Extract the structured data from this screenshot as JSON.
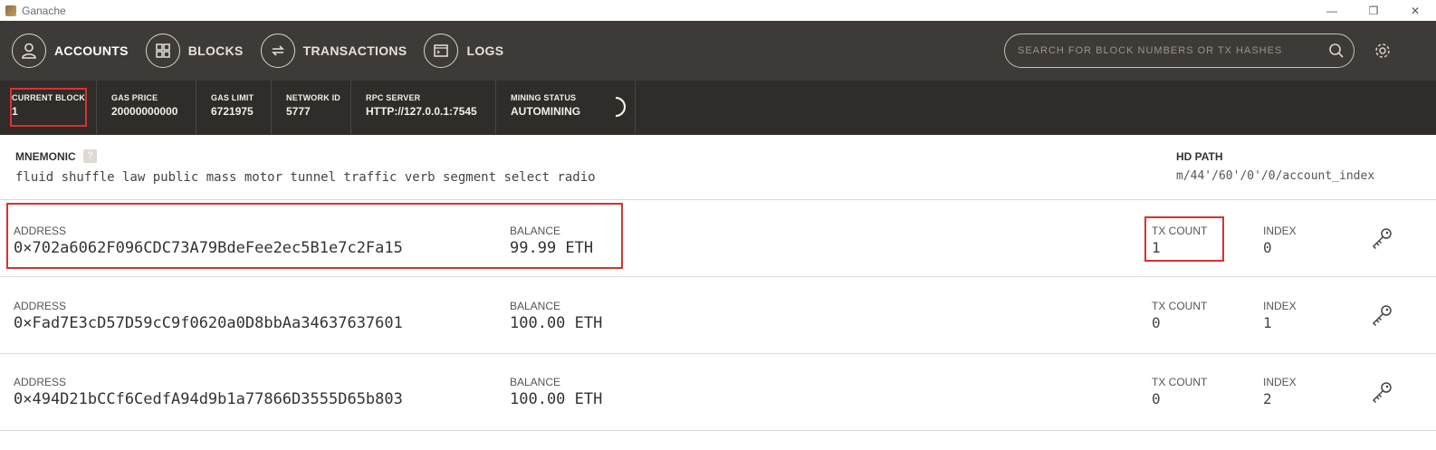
{
  "window": {
    "title": "Ganache",
    "minimize": "—",
    "restore": "❐",
    "close": "✕"
  },
  "nav": {
    "items": [
      {
        "label": "ACCOUNTS",
        "icon": "account-icon"
      },
      {
        "label": "BLOCKS",
        "icon": "blocks-icon"
      },
      {
        "label": "TRANSACTIONS",
        "icon": "transactions-icon"
      },
      {
        "label": "LOGS",
        "icon": "logs-icon"
      }
    ],
    "search_placeholder": "SEARCH FOR BLOCK NUMBERS OR TX HASHES"
  },
  "status": {
    "current_block": {
      "label": "CURRENT BLOCK",
      "value": "1"
    },
    "gas_price": {
      "label": "GAS PRICE",
      "value": "20000000000"
    },
    "gas_limit": {
      "label": "GAS LIMIT",
      "value": "6721975"
    },
    "network_id": {
      "label": "NETWORK ID",
      "value": "5777"
    },
    "rpc_server": {
      "label": "RPC SERVER",
      "value": "HTTP://127.0.0.1:7545"
    },
    "mining_status": {
      "label": "MINING STATUS",
      "value": "AUTOMINING"
    }
  },
  "mnemonic": {
    "label": "MNEMONIC",
    "help": "?",
    "value": "fluid shuffle law public mass motor tunnel traffic verb segment select radio",
    "hd_path_label": "HD PATH",
    "hd_path_value": "m/44'/60'/0'/0/account_index"
  },
  "labels": {
    "address": "ADDRESS",
    "balance": "BALANCE",
    "tx_count": "TX COUNT",
    "index": "INDEX"
  },
  "accounts": [
    {
      "address": "0×702a6062F096CDC73A79BdeFee2ec5B1e7c2Fa15",
      "balance": "99.99 ETH",
      "tx_count": "1",
      "index": "0"
    },
    {
      "address": "0×Fad7E3cD57D59cC9f0620a0D8bbAa34637637601",
      "balance": "100.00 ETH",
      "tx_count": "0",
      "index": "1"
    },
    {
      "address": "0×494D21bCCf6CedfA94d9b1a77866D3555D65b803",
      "balance": "100.00 ETH",
      "tx_count": "0",
      "index": "2"
    }
  ],
  "colors": {
    "nav_bg": "#3d3a38",
    "status_bg": "#2f2c2a",
    "highlight": "#d9322e"
  }
}
